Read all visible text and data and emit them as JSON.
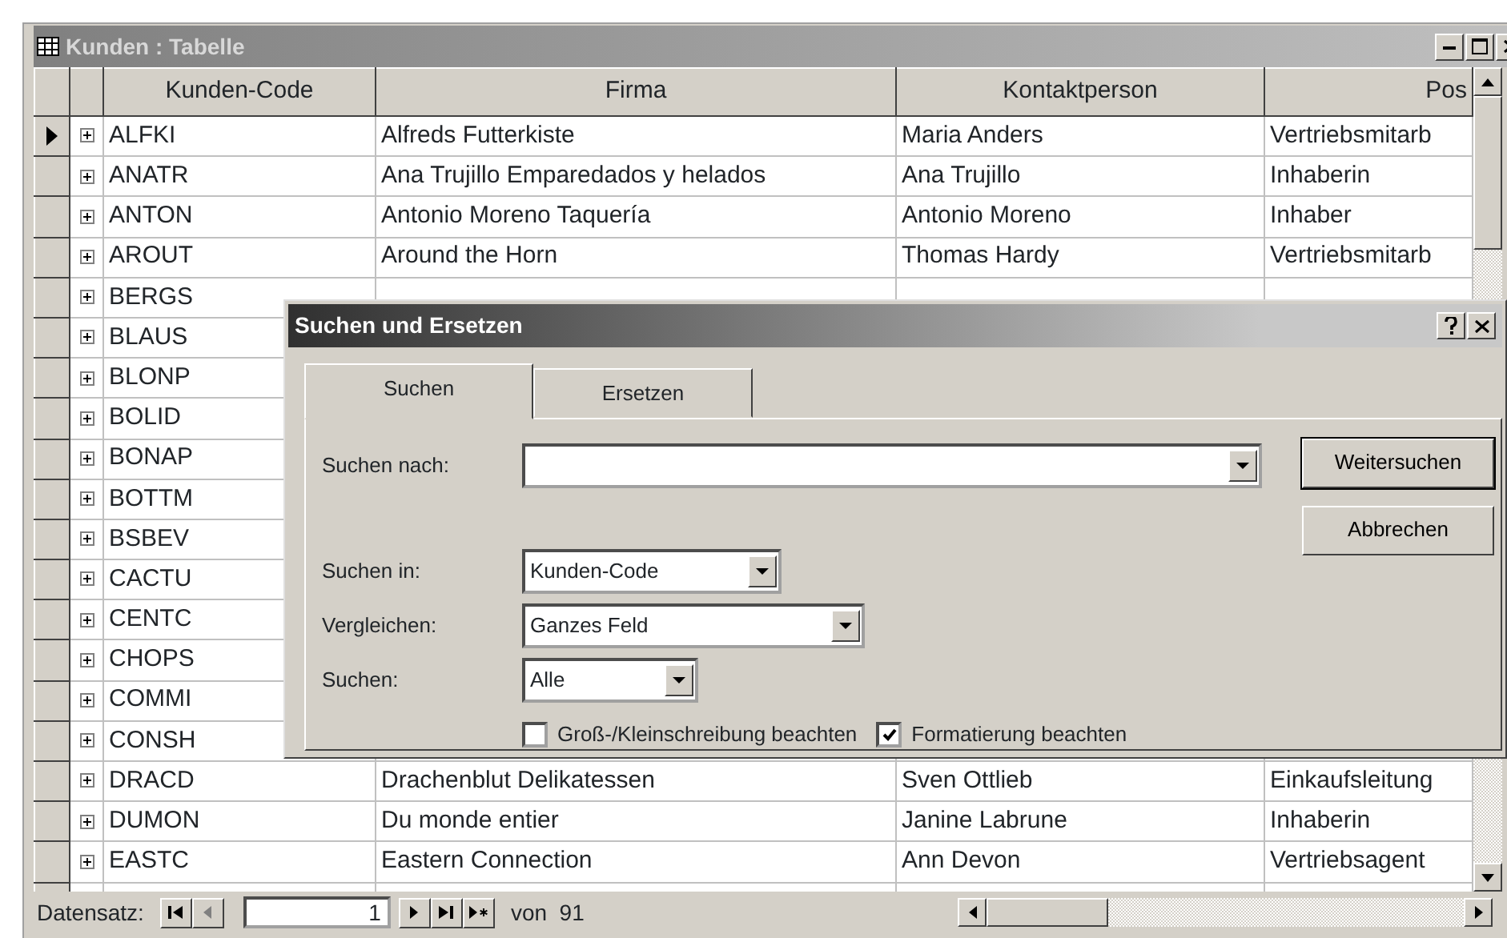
{
  "window": {
    "title": "Kunden : Tabelle"
  },
  "columns": [
    "Kunden-Code",
    "Firma",
    "Kontaktperson",
    "Pos"
  ],
  "rows": [
    {
      "code": "ALFKI",
      "firma": "Alfreds Futterkiste",
      "kontakt": "Maria Anders",
      "position": "Vertriebsmitarb",
      "selected": true,
      "expanded": false
    },
    {
      "code": "ANATR",
      "firma": "Ana Trujillo Emparedados y helados",
      "kontakt": "Ana Trujillo",
      "position": "Inhaberin",
      "selected": false,
      "expanded": false
    },
    {
      "code": "ANTON",
      "firma": "Antonio Moreno Taquería",
      "kontakt": "Antonio Moreno",
      "position": "Inhaber",
      "selected": false,
      "expanded": false
    },
    {
      "code": "AROUT",
      "firma": "Around the Horn",
      "kontakt": "Thomas Hardy",
      "position": "Vertriebsmitarb",
      "selected": false,
      "expanded": false
    },
    {
      "code": "BERGS",
      "selected": false,
      "expanded": false
    },
    {
      "code": "BLAUS",
      "selected": false,
      "expanded": false
    },
    {
      "code": "BLONP",
      "selected": false,
      "expanded": false
    },
    {
      "code": "BOLID",
      "selected": false,
      "expanded": false
    },
    {
      "code": "BONAP",
      "selected": false,
      "expanded": false
    },
    {
      "code": "BOTTM",
      "selected": false,
      "expanded": false
    },
    {
      "code": "BSBEV",
      "selected": false,
      "expanded": false
    },
    {
      "code": "CACTU",
      "selected": false,
      "expanded": false
    },
    {
      "code": "CENTC",
      "selected": false,
      "expanded": false
    },
    {
      "code": "CHOPS",
      "selected": false,
      "expanded": false
    },
    {
      "code": "COMMI",
      "selected": false,
      "expanded": false
    },
    {
      "code": "CONSH",
      "selected": false,
      "expanded": false
    },
    {
      "code": "DRACD",
      "firma": "Drachenblut Delikatessen",
      "kontakt": "Sven Ottlieb",
      "position": "Einkaufsleitung",
      "selected": false,
      "expanded": false
    },
    {
      "code": "DUMON",
      "firma": "Du monde entier",
      "kontakt": "Janine Labrune",
      "position": "Inhaberin",
      "selected": false,
      "expanded": false
    },
    {
      "code": "EASTC",
      "firma": "Eastern Connection",
      "kontakt": "Ann Devon",
      "position": "Vertriebsagent",
      "selected": false,
      "expanded": false
    }
  ],
  "navigation": {
    "label": "Datensatz:",
    "current": "1",
    "total": "von  91"
  },
  "dialog": {
    "title": "Suchen und Ersetzen",
    "tabs": [
      {
        "label": "Suchen",
        "selected": true
      },
      {
        "label": "Ersetzen",
        "selected": false
      }
    ],
    "search_for": {
      "label": "Suchen nach:"
    },
    "fields": [
      {
        "label": "Suchen in:",
        "value": "Kunden-Code",
        "kind": "short"
      },
      {
        "label": "Vergleichen:",
        "value": "Ganzes Feld",
        "kind": "wide"
      },
      {
        "label": "Suchen:",
        "value": "Alle",
        "kind": "narrow"
      }
    ],
    "checkboxes": [
      {
        "label": "Groß-/Kleinschreibung beachten",
        "checked": false
      },
      {
        "label": "Formatierung beachten",
        "checked": true
      }
    ],
    "buttons": [
      {
        "label": "Weitersuchen",
        "kind": "default"
      },
      {
        "label": "Abbrechen",
        "kind": "normal"
      }
    ]
  }
}
